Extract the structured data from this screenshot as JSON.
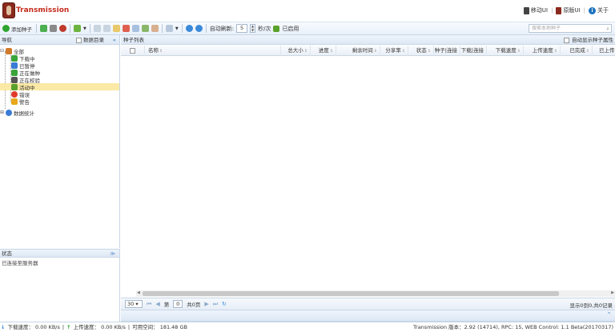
{
  "header": {
    "title": "Transmission",
    "links": [
      {
        "label": "移动UI",
        "icon": "mobile-icon"
      },
      {
        "label": "原版UI",
        "icon": "original-ui-icon"
      },
      {
        "label": "关于",
        "icon": "info-icon"
      }
    ]
  },
  "toolbar": {
    "add_torrent_label": "添加种子",
    "auto_refresh_label": "自动刷新:",
    "refresh_value": "5",
    "refresh_unit": "秒/次",
    "enabled_label": "已启用",
    "search_placeholder": "搜索本地种子"
  },
  "nav": {
    "title": "导航",
    "dir_label": "数据目录",
    "tree": [
      {
        "label": "全部",
        "icon": "home-icon",
        "color": "#d07a2a"
      },
      {
        "label": "下载中",
        "icon": "download-icon",
        "color": "#3aa53a"
      },
      {
        "label": "已暂停",
        "icon": "pause-icon",
        "color": "#3a7bd5"
      },
      {
        "label": "正在做种",
        "icon": "seed-icon",
        "color": "#3aa53a"
      },
      {
        "label": "正在校验",
        "icon": "check-icon",
        "color": "#555555"
      },
      {
        "label": "活动中",
        "icon": "active-icon",
        "color": "#5aa02c"
      },
      {
        "label": "错误",
        "icon": "error-icon",
        "color": "#e03a2a"
      },
      {
        "label": "警告",
        "icon": "warning-icon",
        "color": "#e8a81a"
      },
      {
        "label": "数据统计",
        "icon": "stats-icon",
        "color": "#3a7bd5"
      }
    ]
  },
  "status_panel": {
    "title": "状态",
    "message": "已连接至服务器"
  },
  "list": {
    "title": "种子列表",
    "auto_show_label": "自动显示种子属性",
    "columns": [
      "名称",
      "总大小",
      "进度",
      "剩余时间",
      "分享率",
      "状态",
      "种子",
      "下载",
      "下载速度",
      "上传速度",
      "已完成",
      "已上传"
    ],
    "seed_col": "种子|连接",
    "dl_col": "下载|连接"
  },
  "pager": {
    "page_size": "30",
    "page_prefix": "第",
    "page_value": "0",
    "page_total": "共0页",
    "summary": "显示0到0,共0记录"
  },
  "statusbar": {
    "download": "下载速度： 0.00 KB/s",
    "upload": "上传速度： 0.00 KB/s",
    "free_space": "可用空间： 181.48 GB",
    "version": "Transmission 版本：2.92 (14714), RPC: 15, WEB Control: 1.1 Beta(20170317)"
  }
}
